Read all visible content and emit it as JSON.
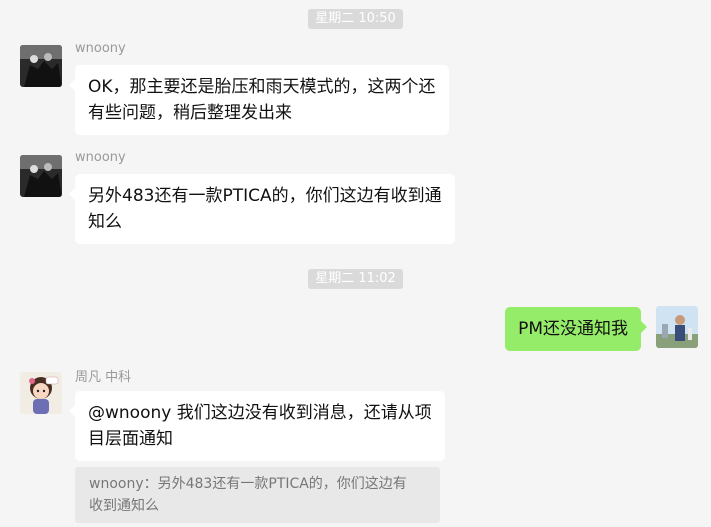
{
  "timestamps": [
    "星期二 10:50",
    "星期二 11:02"
  ],
  "messages": [
    {
      "sender": "wnoony",
      "text_lines": [
        "OK，那主要还是胎压和雨天模式的，这两个还",
        "有些问题，稍后整理发出来"
      ]
    },
    {
      "sender": "wnoony",
      "text_lines": [
        "另外483还有一款PTICA的，你们这边有收到通",
        "知么"
      ]
    },
    {
      "text": "PM还没通知我"
    },
    {
      "sender": "周凡 中科",
      "text_lines": [
        "@wnoony 我们这边没有收到消息，还请从项",
        "目层面通知"
      ],
      "quote_lines": [
        "wnoony：另外483还有一款PTICA的，你们这边有",
        "收到通知么"
      ]
    }
  ],
  "colors": {
    "background": "#f5f5f5",
    "sent_bubble": "#95ec69",
    "received_bubble": "#ffffff",
    "timestamp_bg": "#dadada",
    "quote_bg": "#e8e8e8"
  }
}
